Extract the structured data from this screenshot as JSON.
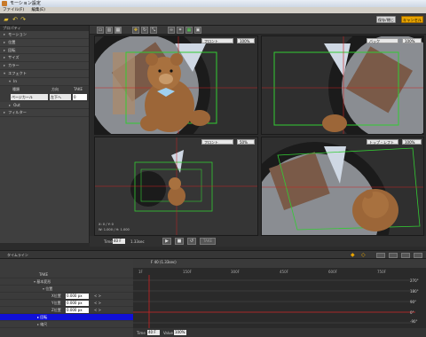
{
  "window": {
    "title": "モーション設定"
  },
  "menu": [
    "ファイル(F)",
    "編集(E)"
  ],
  "toolbar": {
    "save_label": "保存/閉じる",
    "cancel_label": "キャンセル"
  },
  "properties": {
    "header": "プロパティ",
    "items": [
      "モーション",
      "位置",
      "回転",
      "サイズ",
      "カラー",
      "エフェクト"
    ],
    "sub_in": "In",
    "sub_out": "Out",
    "filter": "フィルター",
    "cols": [
      "種類",
      "方向",
      "TAKE"
    ],
    "row_values": [
      "ページカール",
      "左下へ",
      "0"
    ]
  },
  "views": [
    {
      "name": "フロント",
      "zoom": "100%"
    },
    {
      "name": "バック",
      "zoom": "100%"
    },
    {
      "name": "フロント",
      "zoom": "50%"
    },
    {
      "name": "トップ・レフト",
      "zoom": "100%"
    }
  ],
  "view3_info": [
    "X: 0 / Y: 0",
    "W: 1.000 / H: 1.000"
  ],
  "playbar": {
    "time_label": "Time",
    "time_value": "40 F",
    "duration": "1.33sec",
    "take_label": "TAKE"
  },
  "timeline": {
    "header": "タイムライン",
    "take": "TAKE",
    "playhead": "F 40 (1.33sec)",
    "rows": [
      {
        "label": "基本変形",
        "value": ""
      },
      {
        "label": "位置",
        "value": ""
      },
      {
        "label": "X位置",
        "value": "0.000 px"
      },
      {
        "label": "Y位置",
        "value": "0.000 px"
      },
      {
        "label": "Z位置",
        "value": "0.000 px"
      },
      {
        "label": "回転",
        "value": ""
      },
      {
        "label": "縮尺",
        "value": ""
      }
    ],
    "ticks": [
      "1F",
      "150F",
      "300F",
      "450F",
      "600F",
      "750F"
    ],
    "right_ticks": [
      "270°",
      "180°",
      "90°",
      "0°",
      "-90°"
    ],
    "bottom": {
      "time_label": "Time",
      "time_value": "40 F",
      "value_label": "Value",
      "value_value": "100%"
    }
  },
  "colors": {
    "accent": "#e8a400",
    "selection": "#1010d8",
    "guide_green": "#33cc33",
    "guide_red": "#cc2222"
  }
}
